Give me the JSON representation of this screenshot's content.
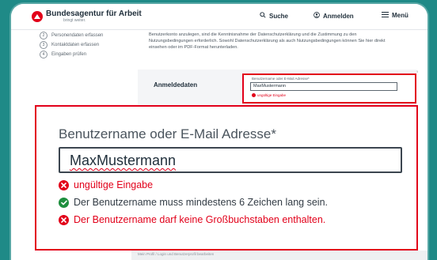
{
  "colors": {
    "accent_red": "#e2001a",
    "success_green": "#1e8e3e",
    "frame_teal": "#1f8a87"
  },
  "header": {
    "brand_name": "Bundesagentur für Arbeit",
    "brand_claim": "bringt weiter.",
    "search_label": "Suche",
    "login_label": "Anmelden",
    "menu_label": "Menü"
  },
  "stepper": {
    "steps": [
      {
        "number": "2",
        "label": "Personendaten erfassen"
      },
      {
        "number": "3",
        "label": "Kontaktdaten erfassen"
      },
      {
        "number": "4",
        "label": "Eingaben prüfen"
      }
    ]
  },
  "intro_text": "Benutzerkonto anzulegen, sind die Kenntnisnahme der Datenschutzerklärung und die Zustimmung zu den Nutzungsbedingungen erforderlich. Sowohl Datenschutzerklärung als auch Nutzungsbedingungen können Sie hier direkt einsehen oder im PDF-Format herunterladen.",
  "required_hint": "Bitte alle mit * markierten Felder ausfüllen",
  "section_title": "Anmeldedaten",
  "footer_text": "Mein Profil / Login und Benutzerprofil bearbeiten",
  "field": {
    "label": "Benutzername oder E-Mail Adresse*",
    "value": "MaxMustermann",
    "error_short": "ungültige Eingabe"
  },
  "validation": [
    {
      "status": "error",
      "icon": "error-x-icon",
      "text": "ungültige Eingabe"
    },
    {
      "status": "ok",
      "icon": "check-icon",
      "text": "Der Benutzername muss mindestens 6 Zeichen lang sein."
    },
    {
      "status": "error",
      "icon": "error-x-icon",
      "text": "Der Benutzername darf keine Großbuchstaben enthalten."
    }
  ]
}
